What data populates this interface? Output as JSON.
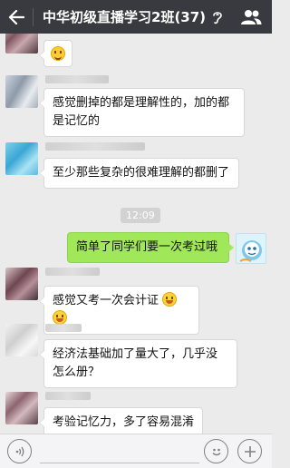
{
  "header": {
    "title": "中华初级直播学习2班(37)",
    "back_icon": "back-arrow-icon",
    "ear_icon": "ear-icon",
    "group_icon": "group-members-icon",
    "bg_color": "#393a3f"
  },
  "messages": [
    {
      "side": "left",
      "text": "",
      "emoji": "smile"
    },
    {
      "side": "left",
      "text": "感觉删掉的都是理解性的，加的都是记忆的"
    },
    {
      "side": "left",
      "text": "至少那些复杂的很难理解的都删了"
    },
    {
      "type": "time",
      "text": "12:09"
    },
    {
      "side": "right",
      "text": "简单了同学们要一次考过哦"
    },
    {
      "side": "left",
      "text": "感觉又考一次会计证",
      "emoji": "laugh-cry x2"
    },
    {
      "side": "left",
      "text": "经济法基础加了量大了，几乎没怎么册？"
    },
    {
      "side": "left",
      "text": "考验记忆力，多了容易混淆"
    }
  ],
  "input_bar": {
    "voice_icon": "voice-icon",
    "emoji_icon": "emoji-icon",
    "plus_icon": "plus-icon"
  },
  "colors": {
    "chat_bg": "#ebebeb",
    "own_bubble": "#a0e759",
    "other_bubble": "#ffffff"
  }
}
